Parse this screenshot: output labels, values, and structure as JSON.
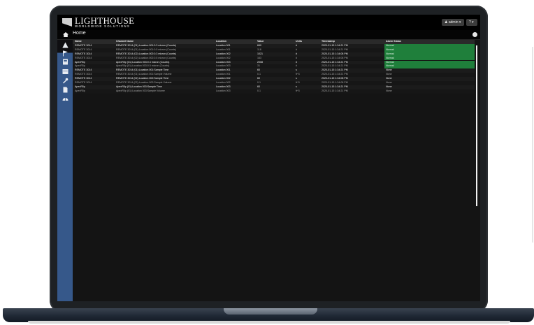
{
  "brand": {
    "name": "LIGHTHOUSE",
    "tagline": "WORLDWIDE SOLUTIONS"
  },
  "header": {
    "user_label": "admin",
    "user_caret": "▾",
    "help_caret": "▾"
  },
  "nav": {
    "title": "Home"
  },
  "colors": {
    "normal_status": "#1f7f3b",
    "sidebar": "#36588a"
  },
  "table": {
    "columns": [
      "Name",
      "Channel Name",
      "Location",
      "Value",
      "Units",
      "Timestamp",
      "Alarm Status"
    ],
    "rows": [
      [
        "REMOTE 3014",
        "REMOTE 3014 (01):Location 001:0.3 micron (Counts)",
        "Location 001",
        "840",
        "#",
        "2020-01-15 1:34:21 PM",
        "Normal"
      ],
      [
        "REMOTE 3014",
        "REMOTE 3014 (01):Location 001:0.5 micron (Counts)",
        "Location 001",
        "118",
        "#",
        "2020-01-15 1:34:21 PM",
        "Normal"
      ],
      [
        "REMOTE 3014",
        "REMOTE 3014 (02):Location 002:0.3 micron (Counts)",
        "Location 002",
        "1021",
        "#",
        "2020-01-15 1:34:08 PM",
        "Normal"
      ],
      [
        "REMOTE 3014",
        "REMOTE 3014 (02):Location 002:0.5 micron (Counts)",
        "Location 002",
        "163",
        "#",
        "2020-01-15 1:34:08 PM",
        "Normal"
      ],
      [
        "ApexR5p",
        "ApexR5p (01):Location 003:0.3 micron (Counts)",
        "Location 003",
        "2008",
        "#",
        "2020-01-15 1:34:21 PM",
        "Normal"
      ],
      [
        "ApexR5p",
        "ApexR5p (01):Location 003:0.5 micron (Counts)",
        "Location 003",
        "31",
        "#",
        "2020-01-15 1:34:21 PM",
        "Normal"
      ],
      [
        "REMOTE 3014",
        "REMOTE 3014 (01):Location 001:Sample Time",
        "Location 001",
        "60",
        "s",
        "2020-01-15 1:34:21 PM",
        "None"
      ],
      [
        "REMOTE 3014",
        "REMOTE 3014 (01):Location 001:Sample Volume",
        "Location 001",
        "0.1",
        "ft^3",
        "2020-01-15 1:34:21 PM",
        "None"
      ],
      [
        "REMOTE 3014",
        "REMOTE 3014 (02):Location 002:Sample Time",
        "Location 002",
        "60",
        "s",
        "2020-01-15 1:34:08 PM",
        "None"
      ],
      [
        "REMOTE 3014",
        "REMOTE 3014 (02):Location 002:Sample Volume",
        "Location 002",
        "0.1",
        "ft^3",
        "2020-01-15 1:34:08 PM",
        "None"
      ],
      [
        "ApexR5p",
        "ApexR5p (01):Location 003:Sample Time",
        "Location 003",
        "60",
        "s",
        "2020-01-15 1:34:21 PM",
        "None"
      ],
      [
        "ApexR5p",
        "ApexR5p (01):Location 003:Sample Volume",
        "Location 003",
        "0.1",
        "ft^3",
        "2020-01-15 1:34:21 PM",
        "None"
      ]
    ]
  }
}
